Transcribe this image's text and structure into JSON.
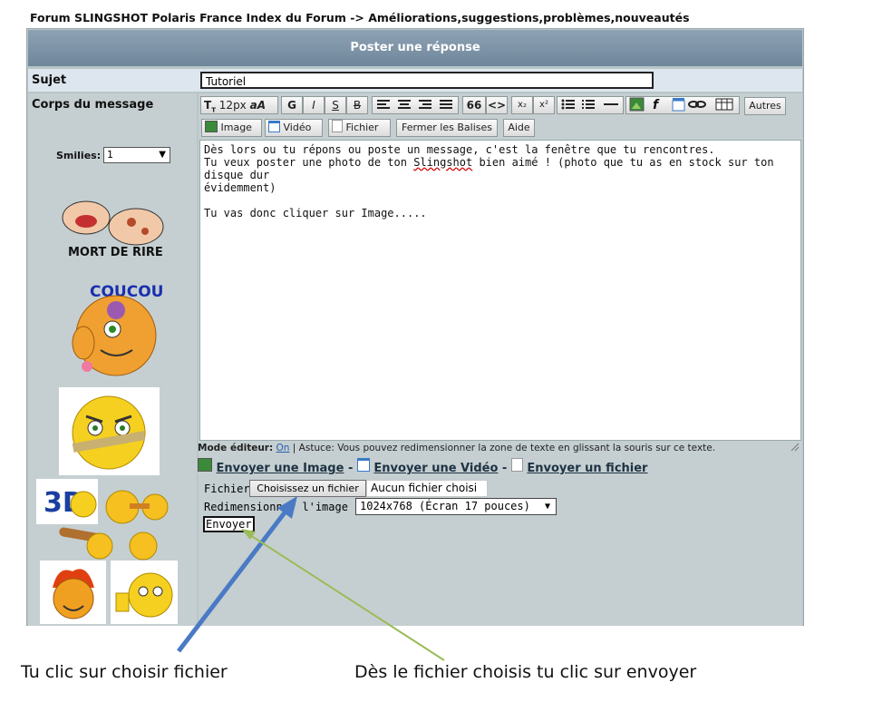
{
  "breadcrumb": "Forum SLINGSHOT Polaris France Index du Forum -> Améliorations,suggestions,problèmes,nouveautés",
  "panel": {
    "title": "Poster une réponse"
  },
  "subject": {
    "label": "Sujet",
    "value": "Tutoriel"
  },
  "body": {
    "label": "Corps du message"
  },
  "smilies": {
    "label": "Smilies:",
    "selected": "1"
  },
  "toolbar": {
    "font_size": "12px",
    "bold": "G",
    "italic": "I",
    "underline": "S",
    "strike": "B",
    "quote": "66",
    "code": "<>",
    "subscript": "x₂",
    "superscript": "x²",
    "others": "Autres",
    "image": "Image",
    "video": "Vidéo",
    "file": "Fichier",
    "close_tags": "Fermer les Balises",
    "help": "Aide"
  },
  "editor": {
    "line1": "Dès lors ou tu répons ou poste un message, c'est la fenêtre que tu rencontres.",
    "line2a": "Tu veux poster une photo de ton ",
    "line2b": "Slingshot",
    "line2c": " bien aimé ! (photo que tu as en stock sur ton disque dur",
    "line3": "évidemment)",
    "line4": "Tu vas donc cliquer sur Image....."
  },
  "mode": {
    "label": "Mode éditeur:",
    "value": "On",
    "hint": "| Astuce: Vous pouvez redimensionner la zone de texte en glissant la souris sur ce texte."
  },
  "send_links": {
    "image": "Envoyer une Image",
    "video": "Envoyer une Vidéo",
    "file": "Envoyer un fichier",
    "sep": " - "
  },
  "upload": {
    "file_label": "Fichier:",
    "choose_button": "Choisissez un fichier",
    "status": "Aucun fichier choisi",
    "resize_label": "Redimensionner l'image ?",
    "resize_value": "1024x768 (Écran 17 pouces)",
    "submit": "Envoyer"
  },
  "smiley_texts": {
    "mort_de_rire": "MORT DE RIRE",
    "coucou": "COUCOU"
  },
  "annotations": {
    "left": "Tu clic sur choisir fichier",
    "right": "Dès le fichier choisis tu clic sur envoyer",
    "arrow_left_color": "#4a7ac4",
    "arrow_right_color": "#9bbb59"
  }
}
